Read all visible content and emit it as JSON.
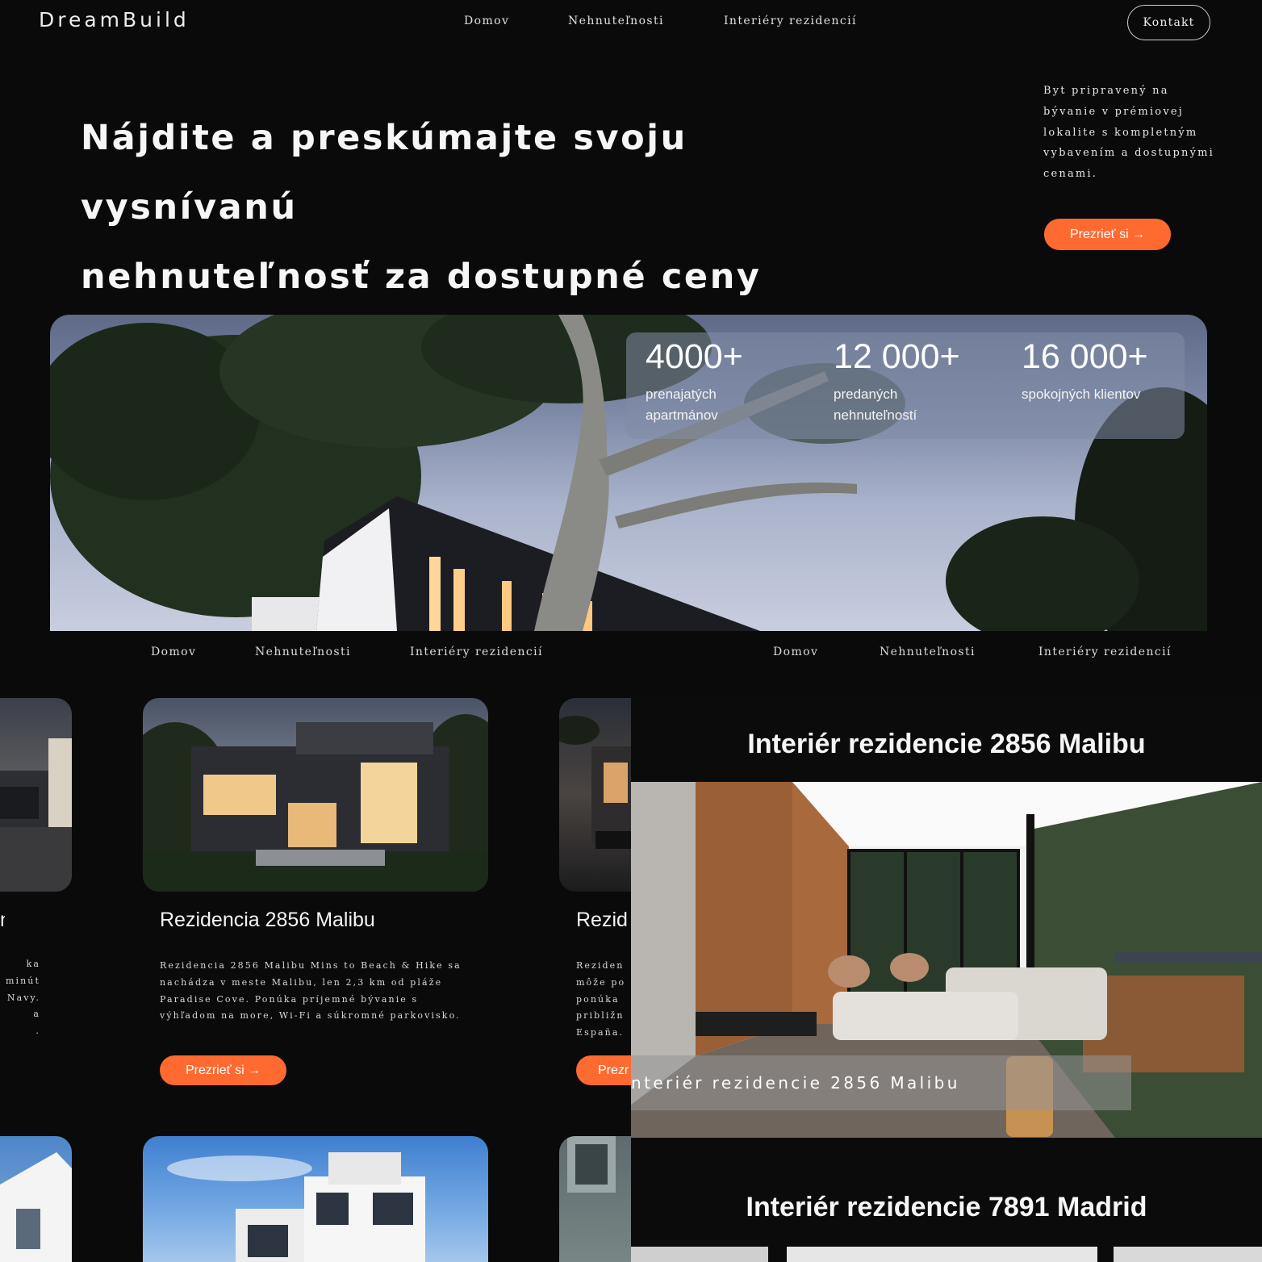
{
  "header": {
    "logo": "DreamBuild",
    "nav": [
      "Domov",
      "Nehnuteľnosti",
      "Interiéry rezidencií"
    ],
    "contact_label": "Kontakt"
  },
  "hero": {
    "title_line1": "Nájdite a preskúmajte svoju vysnívanú",
    "title_line2": "nehnuteľnosť za dostupné ceny",
    "side_text": "Byt pripravený na bývanie v prémiovej lokalite s kompletným vybavením a dostupnými cenami.",
    "cta_label": "Prezrieť si →"
  },
  "stats": [
    {
      "value": "4000+",
      "label": "prenajatých apartmánov"
    },
    {
      "value": "12 000+",
      "label": "predaných nehnuteľností"
    },
    {
      "value": "16 000+",
      "label": "spokojných klientov"
    }
  ],
  "secondary_nav_left": [
    "Domov",
    "Nehnuteľnosti",
    "Interiéry rezidencií"
  ],
  "secondary_nav_right": [
    "Domov",
    "Nehnuteľnosti",
    "Interiéry rezidencií"
  ],
  "cards": {
    "left_partial": {
      "title": "n",
      "desc_lines": [
        "ka",
        "minút",
        "Navy.",
        "a",
        "."
      ]
    },
    "main": {
      "title": "Rezidencia 2856 Malibu",
      "description": "Rezidencia 2856 Malibu Mins to Beach & Hike sa nachádza v meste Malibu, len 2,3 km od pláže Paradise Cove. Ponúka príjemné bývanie s výhľadom na more, Wi-Fi a súkromné parkovisko.",
      "cta_label": "Prezrieť si →"
    },
    "right_partial": {
      "title": "Rezid",
      "desc_lines": [
        "Reziden",
        "môže po",
        "ponúka",
        "približn",
        "España."
      ],
      "cta_label": "Prezr"
    }
  },
  "interior": {
    "heading1": "Interiér rezidencie 2856 Malibu",
    "caption": "nteriér rezidencie 2856 Malibu",
    "heading2": "Interiér rezidencie 7891 Madrid"
  },
  "colors": {
    "background": "#0a0a0b",
    "accent": "#ff6a30",
    "text": "#f2f2f2"
  }
}
